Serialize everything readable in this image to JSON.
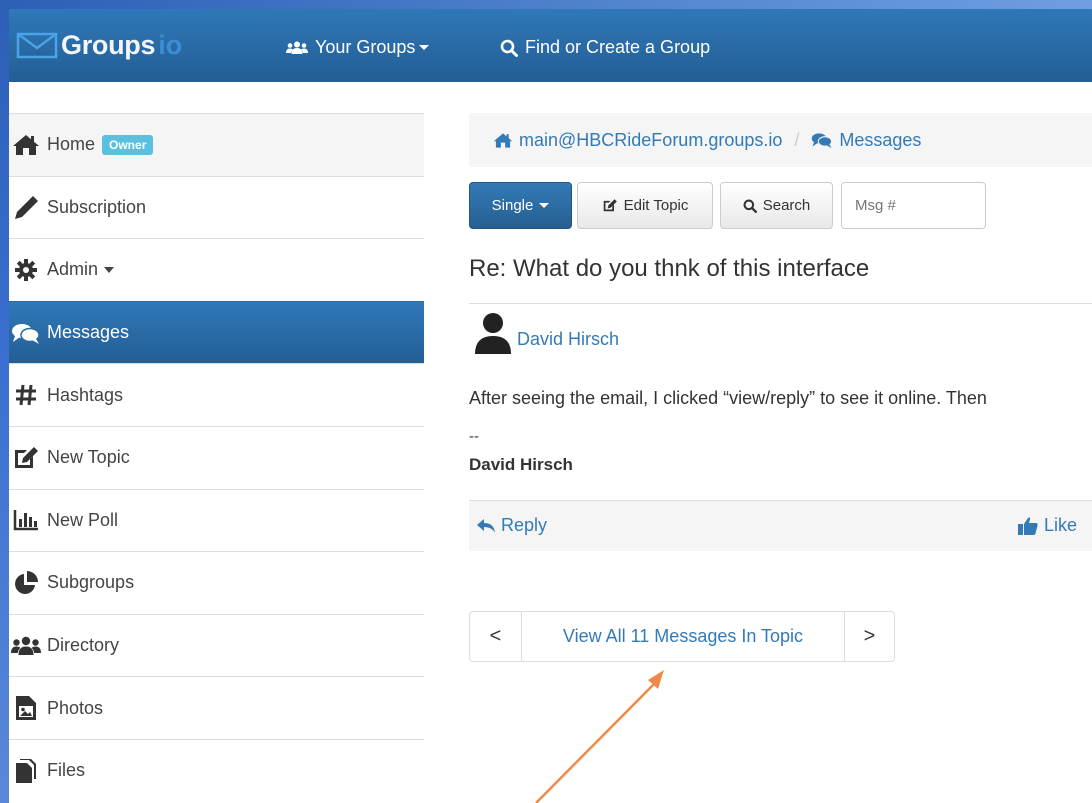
{
  "navbar": {
    "brand": "Groups",
    "brand_suffix": "io",
    "your_groups": "Your Groups",
    "find_create": "Find or Create a Group"
  },
  "sidebar": {
    "items": [
      {
        "label": "Home",
        "icon": "home-icon"
      },
      {
        "label": "Subscription",
        "icon": "pencil-icon"
      },
      {
        "label": "Admin",
        "icon": "gear-icon"
      },
      {
        "label": "Messages",
        "icon": "comments-icon"
      },
      {
        "label": "Hashtags",
        "icon": "hashtag-icon"
      },
      {
        "label": "New Topic",
        "icon": "edit-icon"
      },
      {
        "label": "New Poll",
        "icon": "bar-chart-icon"
      },
      {
        "label": "Subgroups",
        "icon": "pie-chart-icon"
      },
      {
        "label": "Directory",
        "icon": "users-icon"
      },
      {
        "label": "Photos",
        "icon": "photo-icon"
      },
      {
        "label": "Files",
        "icon": "files-icon"
      }
    ],
    "owner_badge": "Owner"
  },
  "breadcrumb": {
    "group": "main@HBCRideForum.groups.io",
    "separator": "/",
    "section": "Messages"
  },
  "toolbar": {
    "single_label": "Single",
    "edit_topic_label": "Edit Topic",
    "search_label": "Search",
    "msg_placeholder": "Msg #"
  },
  "topic": {
    "title": "Re: What do you thnk of this interface",
    "author": "David Hirsch",
    "body": "After seeing the email, I clicked “view/reply” to see it online. Then",
    "sig_dash": "--",
    "sig_name": "David Hirsch"
  },
  "footer": {
    "reply_label": "Reply",
    "like_label": "Like"
  },
  "pager": {
    "prev": "<",
    "view_all": "View All 11 Messages In Topic",
    "next": ">"
  },
  "colors": {
    "navbar": "#2f78b8",
    "link": "#337ab7",
    "badge": "#5bc0de",
    "annotation_arrow": "#f08a4b"
  }
}
